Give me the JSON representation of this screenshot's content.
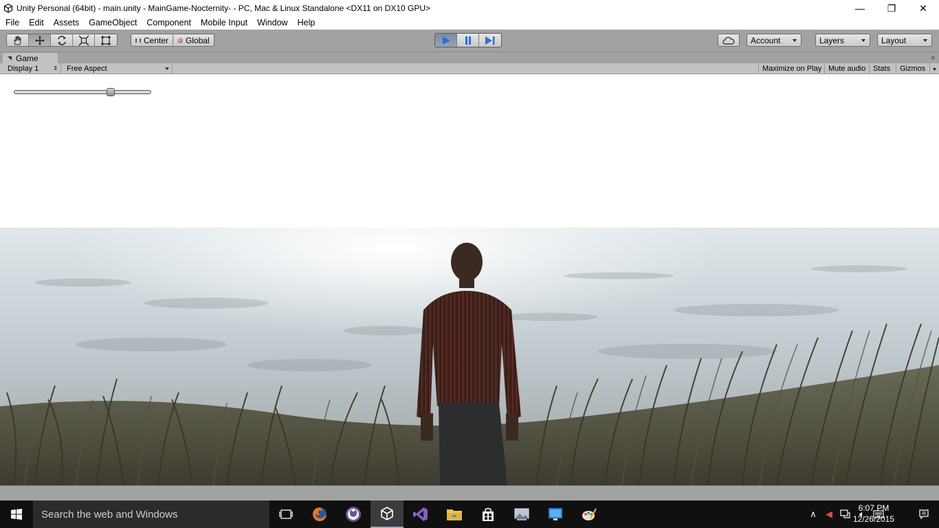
{
  "window": {
    "title": "Unity Personal (64bit) - main.unity - MainGame-Nocternity- - PC, Mac & Linux Standalone <DX11 on DX10 GPU>",
    "minimize": "—",
    "restore": "❐",
    "close": "✕"
  },
  "menu": [
    "File",
    "Edit",
    "Assets",
    "GameObject",
    "Component",
    "Mobile Input",
    "Window",
    "Help"
  ],
  "toolbar": {
    "transform_tools": [
      "hand-icon",
      "move-icon",
      "rotate-icon",
      "scale-icon",
      "rect-icon"
    ],
    "active_tool": "move-icon",
    "pivot": "Center",
    "space": "Global",
    "play_active": true,
    "account": "Account",
    "layers": "Layers",
    "layout": "Layout"
  },
  "game_tab": {
    "label": "Game",
    "display": "Display 1",
    "aspect": "Free Aspect",
    "maximize_on_play": "Maximize on Play",
    "mute_audio": "Mute audio",
    "stats": "Stats",
    "gizmos": "Gizmos"
  },
  "slider": {
    "value": 0.72
  },
  "taskbar": {
    "search_placeholder": "Search the web and Windows",
    "apps": [
      "task-view-icon",
      "firefox-icon",
      "github-icon",
      "unity-icon",
      "visual-studio-icon",
      "file-explorer-icon",
      "store-icon",
      "photos-icon",
      "remote-desktop-icon",
      "paint-icon"
    ],
    "active_app": "unity-icon",
    "time": "6:07 PM",
    "date": "12/26/2015"
  },
  "colors": {
    "editor_bg": "#a2a2a2",
    "play_active": "#2a6ee0",
    "taskbar": "#101010"
  }
}
